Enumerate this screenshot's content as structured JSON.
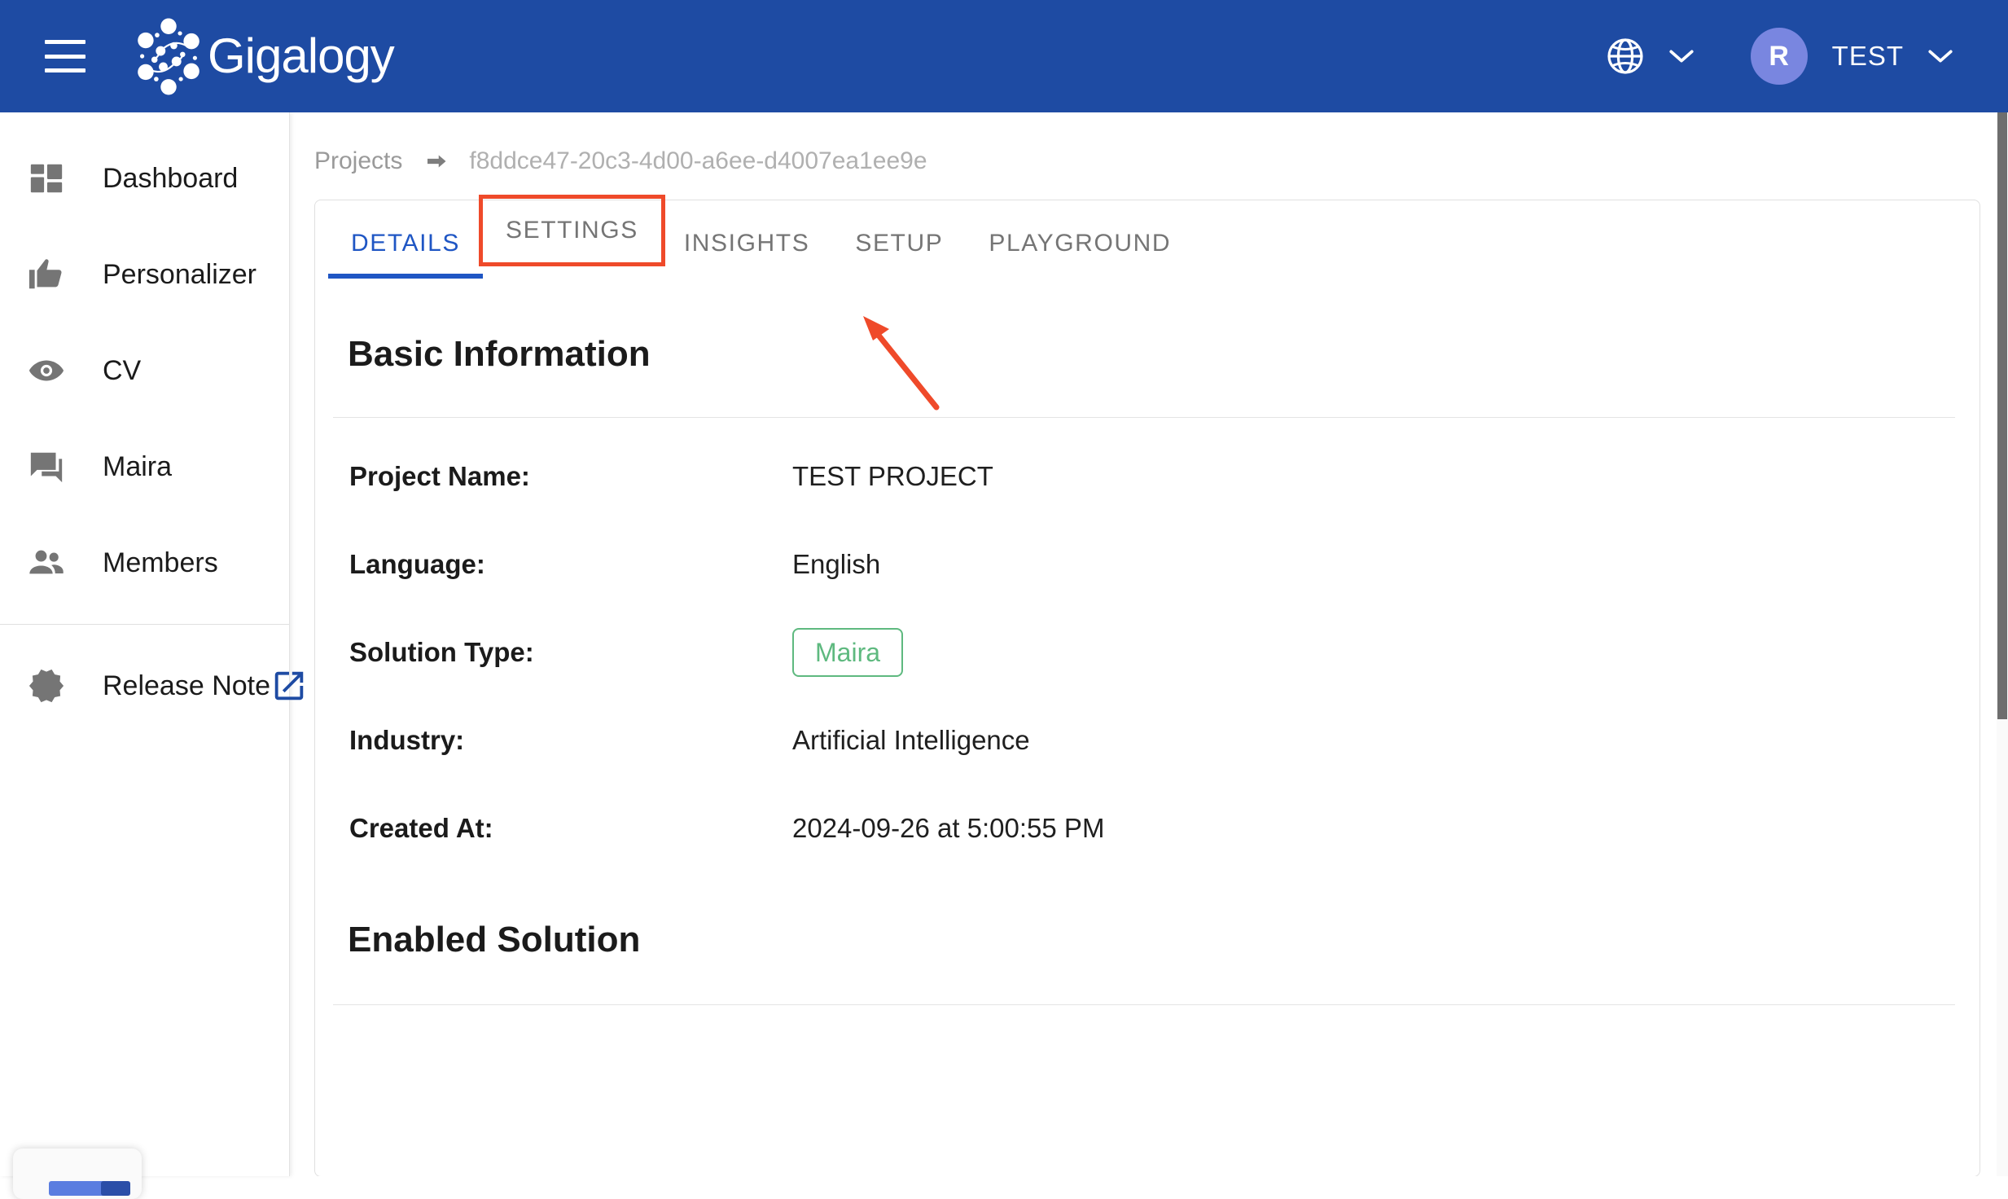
{
  "header": {
    "menu_icon": "hamburger-menu-icon",
    "brand_name": "Gigalogy",
    "language_icon": "globe-icon",
    "language_chevron": "chevron-down-icon",
    "avatar_initial": "R",
    "user_name": "TEST",
    "user_chevron": "chevron-down-icon",
    "bg_color": "#1e4ba3"
  },
  "sidebar": {
    "items": [
      {
        "label": "Dashboard",
        "icon": "dashboard-icon"
      },
      {
        "label": "Personalizer",
        "icon": "thumb-up-icon"
      },
      {
        "label": "CV",
        "icon": "eye-icon"
      },
      {
        "label": "Maira",
        "icon": "chat-icon"
      },
      {
        "label": "Members",
        "icon": "people-icon"
      }
    ],
    "footer_item": {
      "label": "Release Note",
      "icon": "new-releases-icon",
      "external_icon": "open-in-new-icon"
    }
  },
  "breadcrumb": {
    "root": "Projects",
    "separator_icon": "arrow-right-icon",
    "current": "f8ddce47-20c3-4d00-a6ee-d4007ea1ee9e"
  },
  "tabs": [
    {
      "label": "DETAILS",
      "active": true,
      "annotated": false
    },
    {
      "label": "SETTINGS",
      "active": false,
      "annotated": true
    },
    {
      "label": "INSIGHTS",
      "active": false,
      "annotated": false
    },
    {
      "label": "SETUP",
      "active": false,
      "annotated": false
    },
    {
      "label": "PLAYGROUND",
      "active": false,
      "annotated": false
    }
  ],
  "basic_information": {
    "title": "Basic Information",
    "rows": [
      {
        "label": "Project Name:",
        "value": "TEST PROJECT",
        "type": "text"
      },
      {
        "label": "Language:",
        "value": "English",
        "type": "text"
      },
      {
        "label": "Solution Type:",
        "value": "Maira",
        "type": "chip"
      },
      {
        "label": "Industry:",
        "value": "Artificial Intelligence",
        "type": "text"
      },
      {
        "label": "Created At:",
        "value": "2024-09-26 at 5:00:55 PM",
        "type": "text"
      }
    ]
  },
  "enabled_solution": {
    "title": "Enabled Solution"
  },
  "colors": {
    "brand_blue": "#1e4ba3",
    "tab_active": "#1f56c4",
    "annotation_red": "#ef4a2a",
    "chip_green": "#5eb97f",
    "avatar_purple": "#7986e0"
  }
}
